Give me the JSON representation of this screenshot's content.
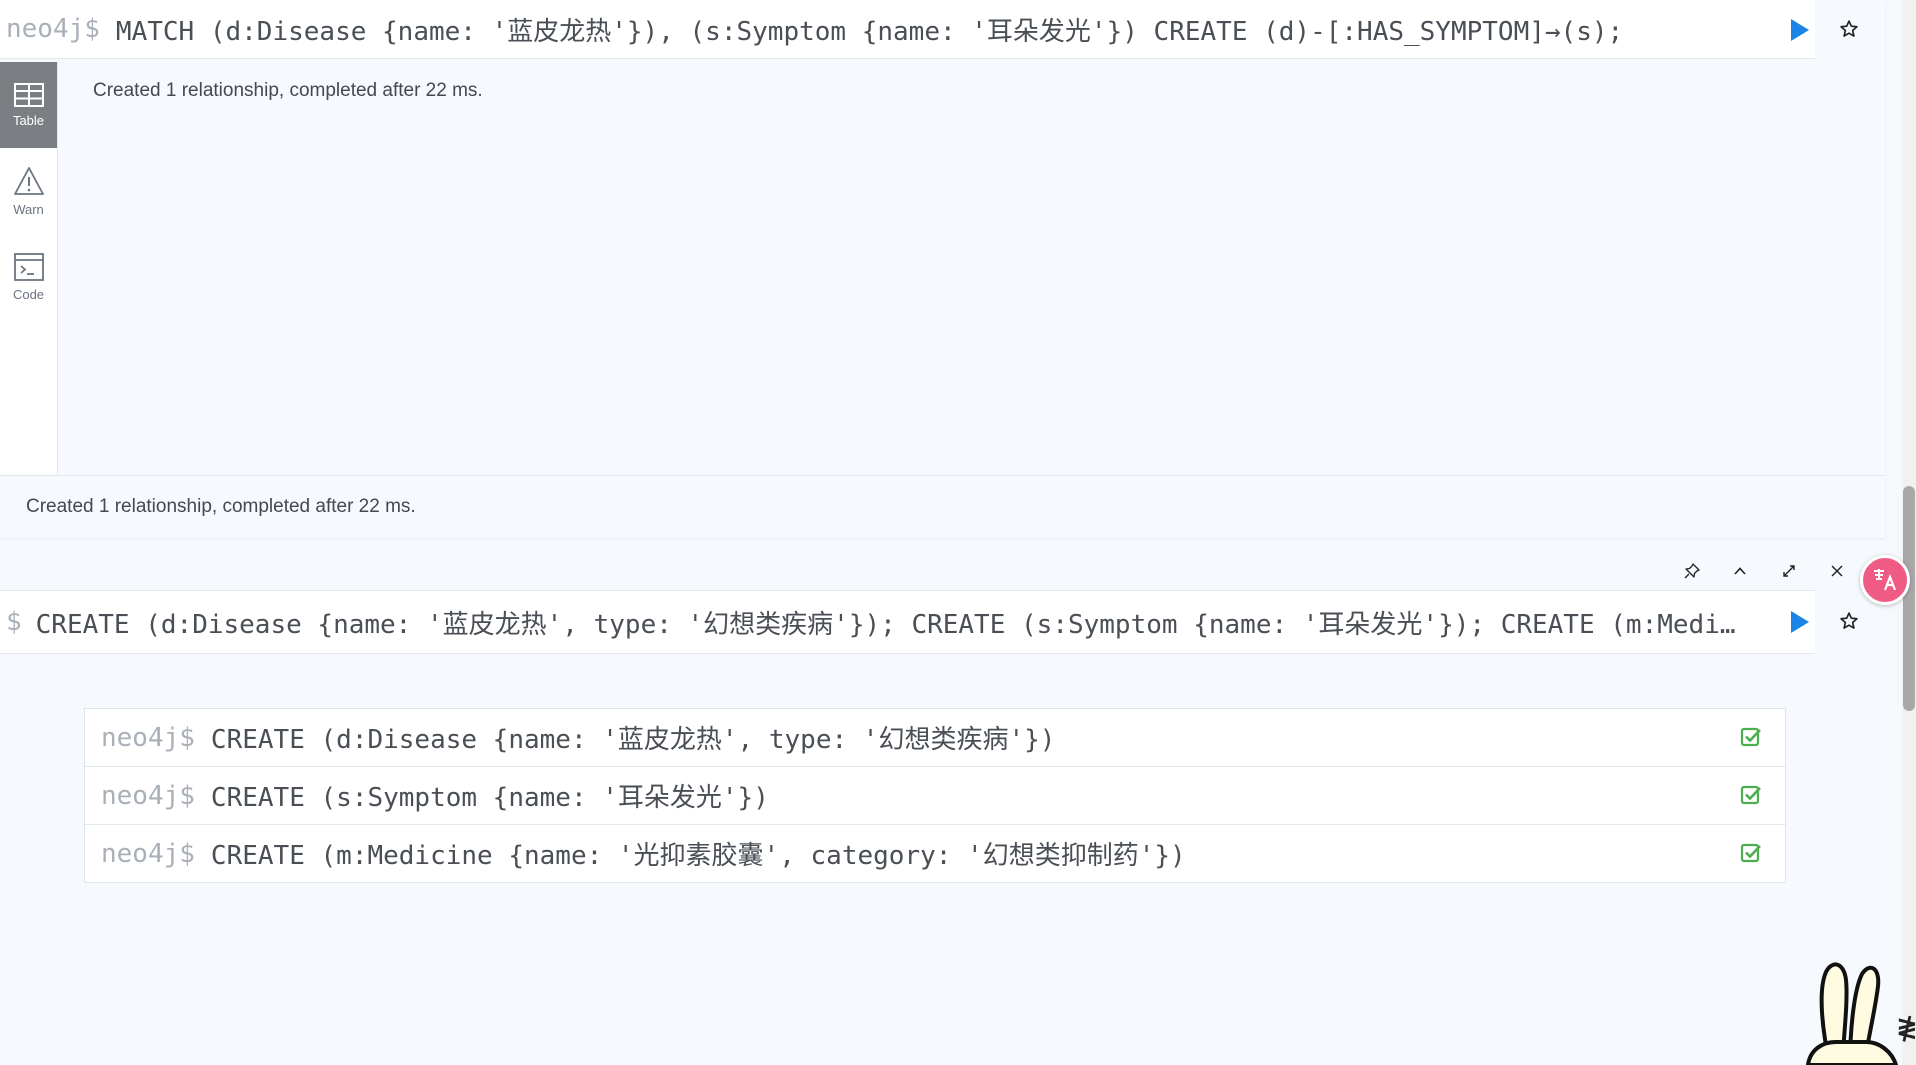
{
  "frame1": {
    "prompt": "neo4j$",
    "command": "MATCH (d:Disease {name: '蓝皮龙热'}), (s:Symptom {name: '耳朵发光'}) CREATE (d)-[:HAS_SYMPTOM]→(s);",
    "sidebar": [
      {
        "label": "Table",
        "icon": "table-icon",
        "active": true
      },
      {
        "label": "Warn",
        "icon": "warning-icon",
        "active": false
      },
      {
        "label": "Code",
        "icon": "code-icon",
        "active": false
      }
    ],
    "result_message": "Created 1 relationship, completed after 22 ms.",
    "status_message": "Created 1 relationship, completed after 22 ms."
  },
  "frame2": {
    "prompt": "$",
    "command": "CREATE (d:Disease {name: '蓝皮龙热', type: '幻想类疾病'}); CREATE (s:Symptom {name: '耳朵发光'}); CREATE (m:Medicin…",
    "statements": [
      {
        "prompt": "neo4j$",
        "code": "CREATE (d:Disease {name: '蓝皮龙热', type: '幻想类疾病'})",
        "status": "success"
      },
      {
        "prompt": "neo4j$",
        "code": "CREATE (s:Symptom {name: '耳朵发光'})",
        "status": "success"
      },
      {
        "prompt": "neo4j$",
        "code": "CREATE (m:Medicine {name: '光抑素胶囊', category: '幻想类抑制药'})",
        "status": "success"
      }
    ]
  },
  "colors": {
    "accent": "#1a83e6",
    "success": "#4cae4c",
    "active_tab": "#7b7f84",
    "translate_bubble": "#f05b86"
  }
}
